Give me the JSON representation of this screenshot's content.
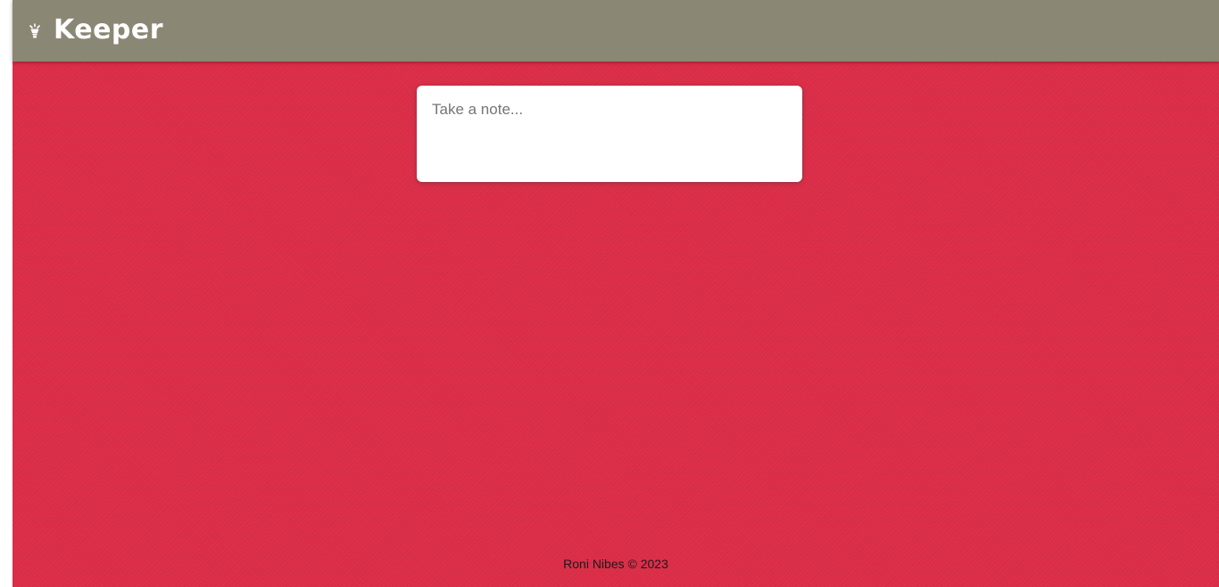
{
  "header": {
    "title": "Keeper",
    "icon": "lightbulb-icon",
    "background": "#8b8775"
  },
  "note_form": {
    "placeholder": "Take a note...",
    "value": ""
  },
  "footer": {
    "text": "Roni Nibes © 2023"
  },
  "colors": {
    "page_background": "#de2d48",
    "header_background": "#8b8775",
    "card_background": "#ffffff"
  }
}
